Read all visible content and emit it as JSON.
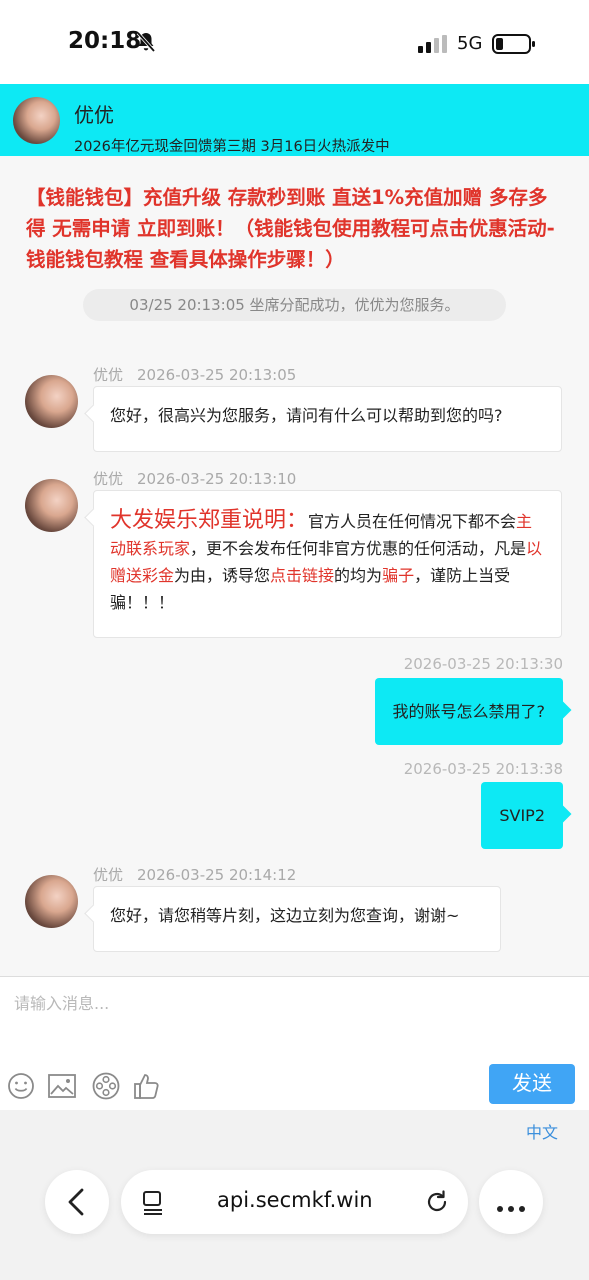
{
  "status_bar": {
    "time": "20:18",
    "network": "5G",
    "icons": [
      "bell-muted-icon",
      "signal-icon",
      "battery-icon"
    ]
  },
  "header": {
    "name": "优优",
    "subtitle": "2026年亿元现金回馈第三期 3月16日火热派发中",
    "background_color": "#0de9f4"
  },
  "announcement": "【钱能钱包】充值升级 存款秒到账 直送1%充值加赠 多存多得  无需申请 立即到账！（钱能钱包使用教程可点击优惠活动-钱能钱包教程 查看具体操作步骤！）",
  "system_notice": "03/25 20:13:05 坐席分配成功，优优为您服务。",
  "messages": [
    {
      "sender": "优优",
      "time": "2026-03-25 20:13:05",
      "text": "您好，很高兴为您服务，请问有什么可以帮助到您的吗?"
    },
    {
      "sender": "优优",
      "time": "2026-03-25 20:13:10",
      "parts": {
        "title": "大发娱乐郑重说明：",
        "p1": "官方人员在任何情况下都不会",
        "r1": "主动联系玩家",
        "p2": "，更不会发布任何非官方优惠的任何活动，凡是",
        "r2": "以赠送彩金",
        "p3": "为由，诱导您",
        "r3": "点击链接",
        "p4": "的均为",
        "r4": "骗子",
        "p5": "，谨防上当受骗！！！"
      }
    },
    {
      "sender": "me",
      "time": "2026-03-25 20:13:30",
      "text": "我的账号怎么禁用了?"
    },
    {
      "sender": "me",
      "time": "2026-03-25 20:13:38",
      "text": "SVIP2"
    },
    {
      "sender": "优优",
      "time": "2026-03-25 20:14:12",
      "text": "您好，请您稍等片刻，这边立刻为您查询，谢谢~"
    }
  ],
  "input": {
    "placeholder": "请输入消息...",
    "value": "",
    "toolbar": [
      "emoji-icon",
      "image-icon",
      "film-reel-icon",
      "thumbs-up-icon"
    ],
    "send_label": "发送",
    "send_color": "#40a5f5"
  },
  "language": "中文",
  "browser": {
    "url": "api.secmkf.win",
    "icons": [
      "back-arrow-icon",
      "tabs-icon",
      "reload-icon",
      "more-icon"
    ]
  },
  "colors": {
    "accent": "#0de9f4",
    "warning_red": "#e0342b",
    "link_blue": "#3b8fdc"
  }
}
